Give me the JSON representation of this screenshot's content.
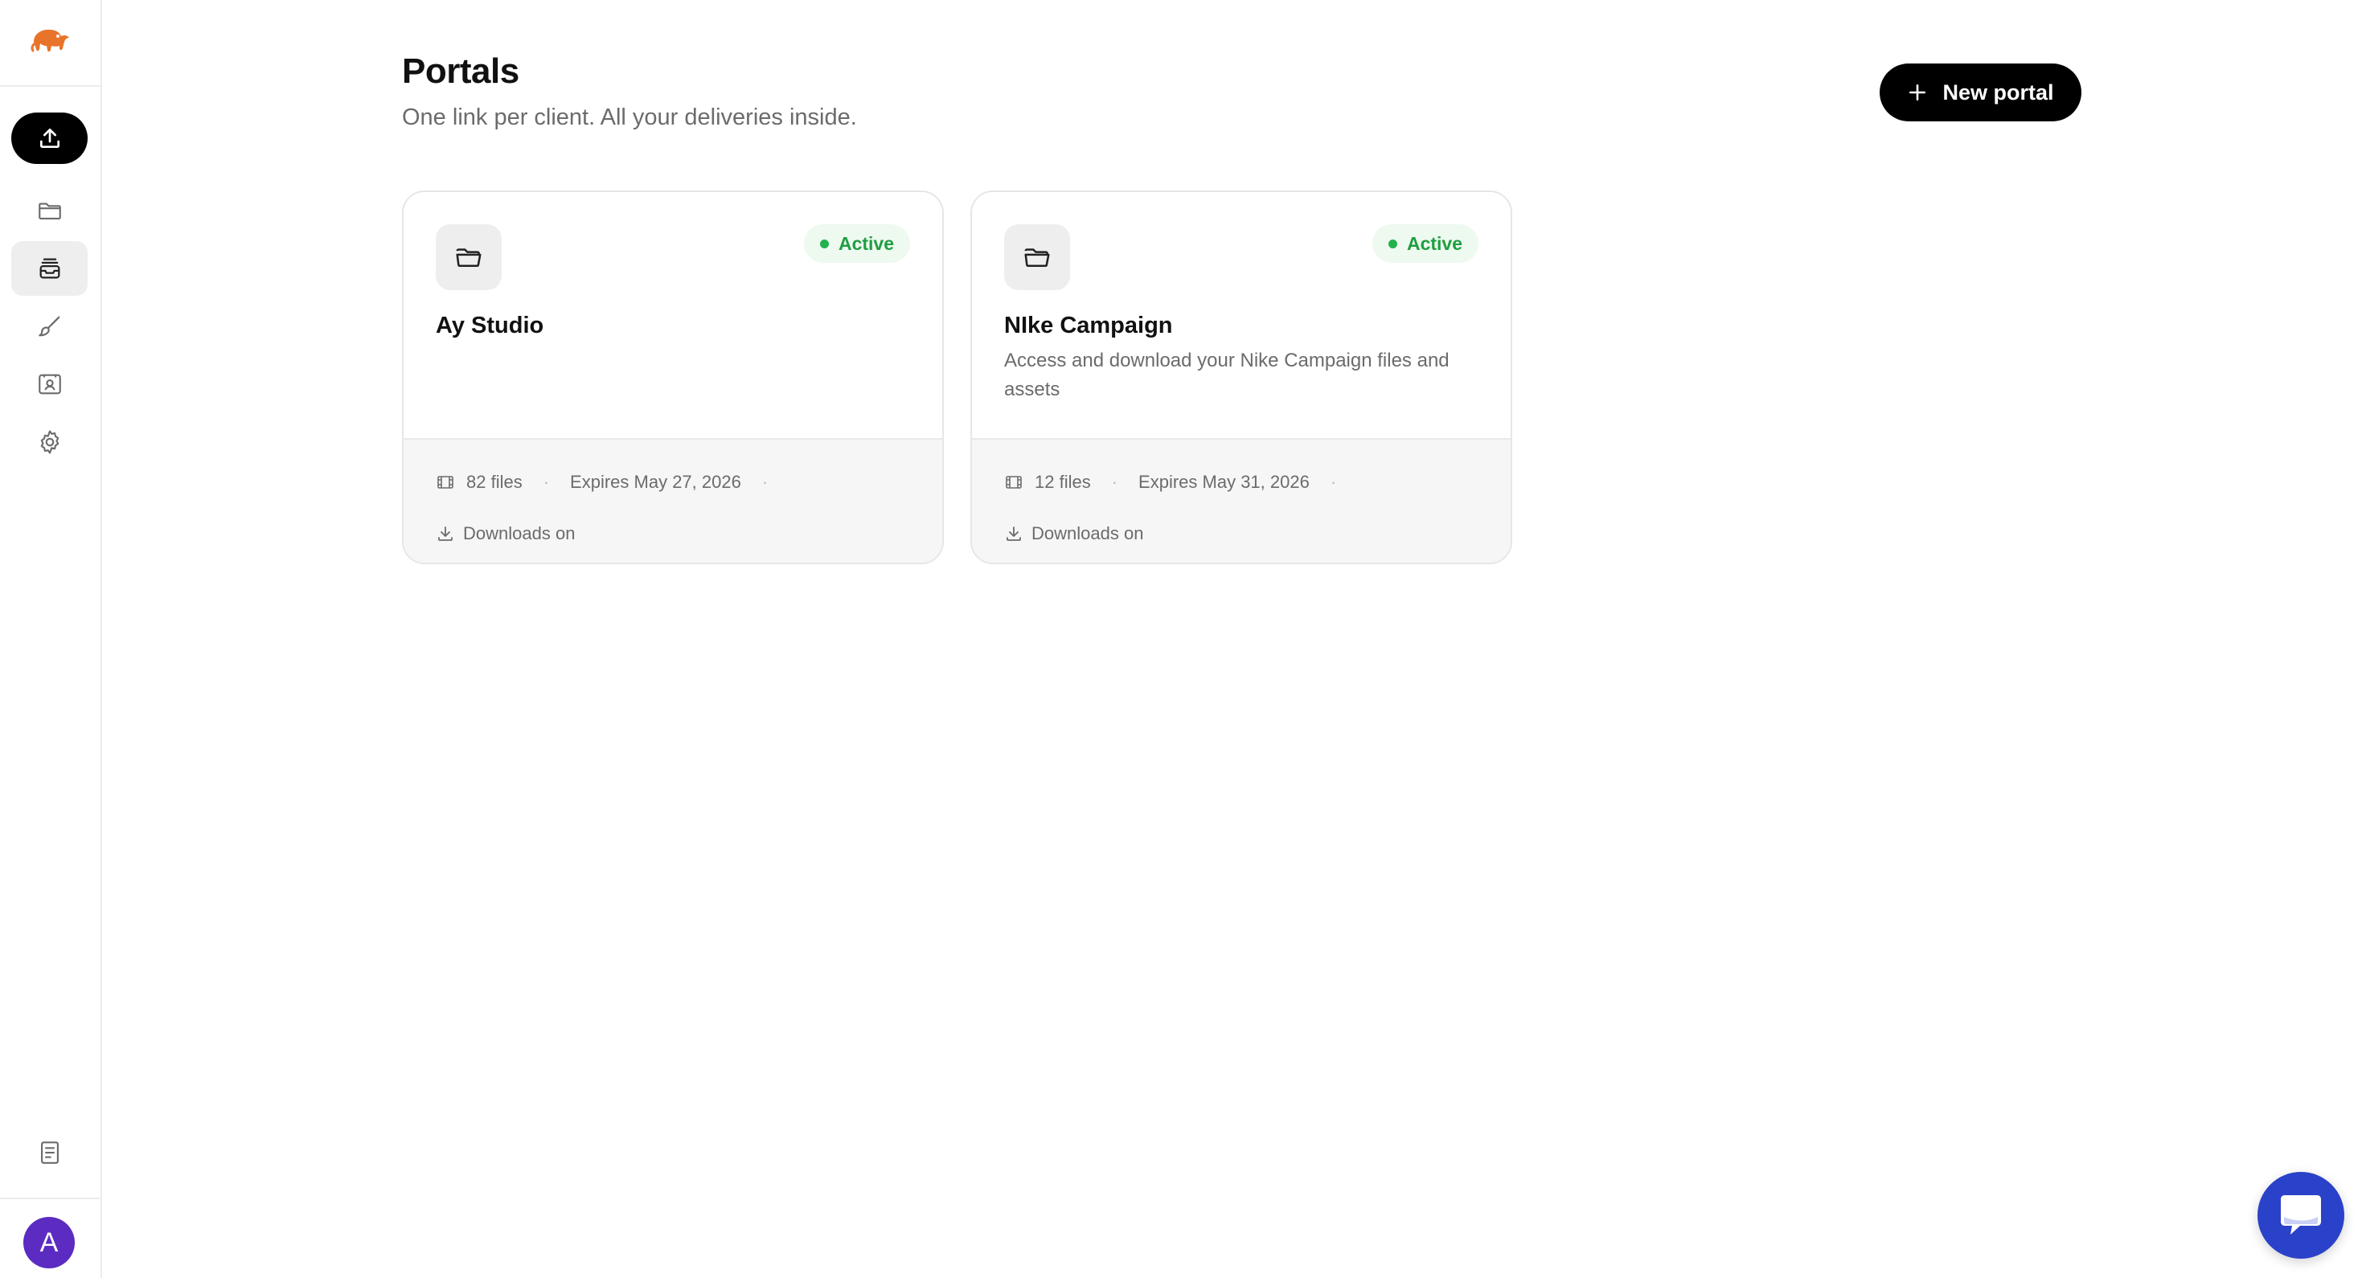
{
  "sidebar": {
    "logo_icon": "elephant-logo-icon",
    "upload_icon": "upload-icon",
    "nav_icons": [
      "folder-icon",
      "inbox-tray-icon",
      "brush-icon",
      "scan-person-icon",
      "gear-icon"
    ],
    "active_nav": "inbox-tray-icon",
    "bottom_icon": "document-icon",
    "avatar_initial": "A",
    "avatar_color": "#5b2bc2"
  },
  "header": {
    "title": "Portals",
    "subtitle": "One link per client. All your deliveries inside.",
    "new_portal_label": "New portal"
  },
  "portals": [
    {
      "name": "Ay Studio",
      "description": "",
      "status": "Active",
      "files": "82 files",
      "expires": "Expires May 27, 2026",
      "downloads": "Downloads on"
    },
    {
      "name": "NIke Campaign",
      "description": "Access and download your Nike Campaign files and assets",
      "status": "Active",
      "files": "12 files",
      "expires": "Expires May 31, 2026",
      "downloads": "Downloads on"
    }
  ],
  "colors": {
    "accent": "#000000",
    "status_green": "#1f9e3f",
    "chat_blue": "#2a41c9"
  },
  "chat": {
    "icon": "chat-bubble-icon"
  }
}
